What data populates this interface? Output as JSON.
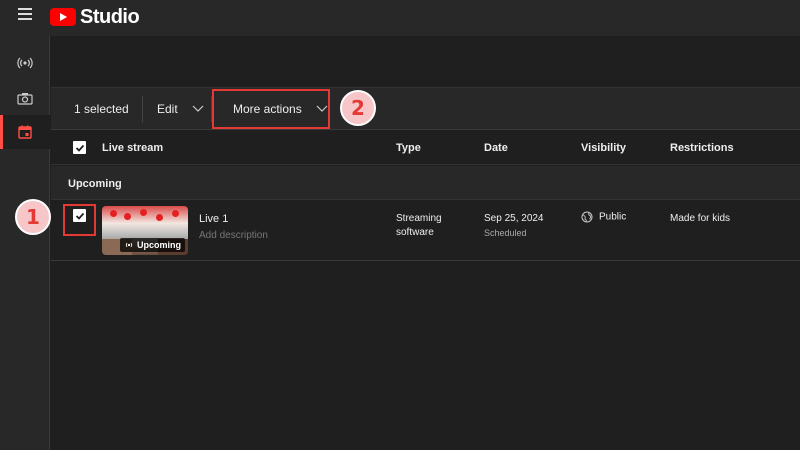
{
  "app": {
    "name": "Studio"
  },
  "sidebar": {
    "items": [
      {
        "icon": "live-broadcast-icon",
        "active": false
      },
      {
        "icon": "camera-icon",
        "active": false
      },
      {
        "icon": "calendar-icon",
        "active": true
      }
    ]
  },
  "actionbar": {
    "selected_label": "1 selected",
    "edit_label": "Edit",
    "more_actions_label": "More actions"
  },
  "table": {
    "headers": {
      "live_stream": "Live stream",
      "type": "Type",
      "date": "Date",
      "visibility": "Visibility",
      "restrictions": "Restrictions"
    },
    "group_label": "Upcoming",
    "rows": [
      {
        "checked": true,
        "title": "Live 1",
        "description_placeholder": "Add description",
        "thumb_badge": "Upcoming",
        "type_line1": "Streaming",
        "type_line2": "software",
        "date": "Sep 25, 2024",
        "date_status": "Scheduled",
        "visibility": "Public",
        "restrictions": "Made for kids"
      }
    ]
  },
  "annotations": {
    "step1": "1",
    "step2": "2"
  },
  "colors": {
    "accent_red": "#e53935",
    "badge_fill": "#f7c6c8",
    "youtube_red": "#ff0000"
  }
}
